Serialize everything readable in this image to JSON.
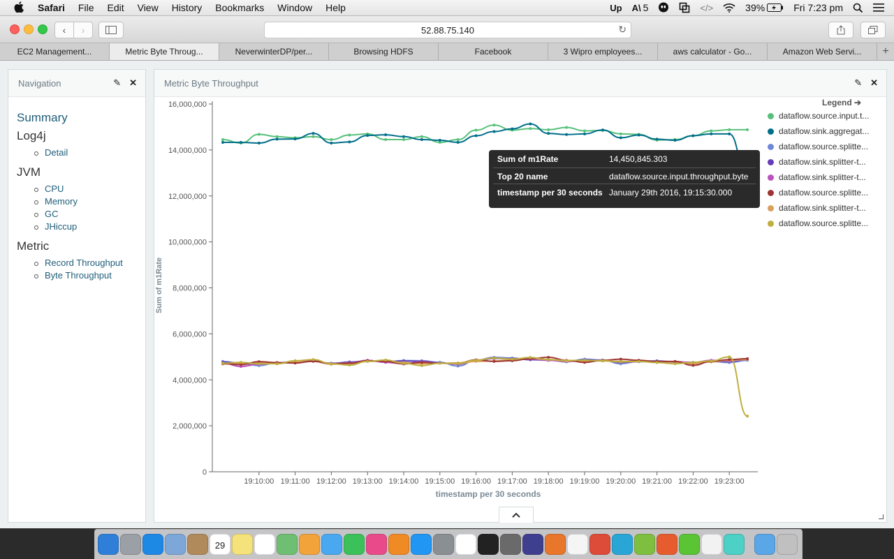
{
  "menubar": {
    "app": "Safari",
    "menus": [
      "File",
      "Edit",
      "View",
      "History",
      "Bookmarks",
      "Window",
      "Help"
    ],
    "notification_count": "5",
    "battery": "39%",
    "clock": "Fri 7:23 pm"
  },
  "browser": {
    "url": "52.88.75.140",
    "tabs": [
      "EC2 Management...",
      "Metric Byte Throug...",
      "NeverwinterDP/per...",
      "Browsing HDFS",
      "Facebook",
      "3 Wipro employees...",
      "aws calculator - Go...",
      "Amazon Web Servi..."
    ],
    "active_tab": 1
  },
  "navigation": {
    "title": "Navigation",
    "summary": "Summary",
    "sections": [
      {
        "heading": "Log4j",
        "items": [
          "Detail"
        ]
      },
      {
        "heading": "JVM",
        "items": [
          "CPU",
          "Memory",
          "GC",
          "JHiccup"
        ]
      },
      {
        "heading": "Metric",
        "items": [
          "Record Throughput",
          "Byte Throughput"
        ]
      }
    ]
  },
  "main_panel": {
    "title": "Metric Byte Throughput"
  },
  "legend": {
    "title": "Legend",
    "items": [
      {
        "label": "dataflow.source.input.t...",
        "color": "#57c17b"
      },
      {
        "label": "dataflow.sink.aggregat...",
        "color": "#006e8a"
      },
      {
        "label": "dataflow.source.splitte...",
        "color": "#6f87d8"
      },
      {
        "label": "dataflow.sink.splitter-t...",
        "color": "#663db8"
      },
      {
        "label": "dataflow.sink.splitter-t...",
        "color": "#bc52bc"
      },
      {
        "label": "dataflow.source.splitte...",
        "color": "#9e3533"
      },
      {
        "label": "dataflow.sink.splitter-t...",
        "color": "#daa05d"
      },
      {
        "label": "dataflow.source.splitte...",
        "color": "#bfaf40"
      }
    ]
  },
  "tooltip": {
    "rows": [
      {
        "key": "Sum of m1Rate",
        "value": "14,450,845.303"
      },
      {
        "key": "Top 20 name",
        "value": "dataflow.source.input.throughput.byte"
      },
      {
        "key": "timestamp per 30 seconds",
        "value": "January 29th 2016, 19:15:30.000"
      }
    ]
  },
  "chart_data": {
    "type": "line",
    "xlabel": "timestamp per 30 seconds",
    "ylabel": "Sum of m1Rate",
    "ylim": [
      0,
      16000000
    ],
    "yticks": [
      "0",
      "2,000,000",
      "4,000,000",
      "6,000,000",
      "8,000,000",
      "10,000,000",
      "12,000,000",
      "14,000,000",
      "16,000,000"
    ],
    "xticks": [
      "19:10:00",
      "19:11:00",
      "19:12:00",
      "19:13:00",
      "19:14:00",
      "19:15:00",
      "19:16:00",
      "19:17:00",
      "19:18:00",
      "19:19:00",
      "19:20:00",
      "19:21:00",
      "19:22:00",
      "19:23:00"
    ],
    "x": [
      "19:09:00",
      "19:09:30",
      "19:10:00",
      "19:10:30",
      "19:11:00",
      "19:11:30",
      "19:12:00",
      "19:12:30",
      "19:13:00",
      "19:13:30",
      "19:14:00",
      "19:14:30",
      "19:15:00",
      "19:15:30",
      "19:16:00",
      "19:16:30",
      "19:17:00",
      "19:17:30",
      "19:18:00",
      "19:18:30",
      "19:19:00",
      "19:19:30",
      "19:20:00",
      "19:20:30",
      "19:21:00",
      "19:21:30",
      "19:22:00",
      "19:22:30",
      "19:23:00",
      "19:23:30"
    ],
    "series": [
      {
        "name": "dataflow.source.input.t...",
        "color": "#57c17b",
        "values": [
          14450000,
          14300000,
          14680000,
          14580000,
          14530000,
          14580000,
          14450000,
          14650000,
          14700000,
          14450000,
          14450000,
          14580000,
          14330000,
          14450000,
          14860000,
          15080000,
          14860000,
          14930000,
          14880000,
          14980000,
          14830000,
          14850000,
          14700000,
          14680000,
          14430000,
          14450000,
          14620000,
          14830000,
          14880000,
          14880000
        ]
      },
      {
        "name": "dataflow.sink.aggregat...",
        "color": "#006e8a",
        "values": [
          14330000,
          14330000,
          14300000,
          14470000,
          14480000,
          14720000,
          14300000,
          14350000,
          14630000,
          14660000,
          14580000,
          14450000,
          14420000,
          14330000,
          14620000,
          14800000,
          14920000,
          15130000,
          14720000,
          14670000,
          14700000,
          14870000,
          14530000,
          14650000,
          14470000,
          14420000,
          14620000,
          14700000,
          14700000,
          12830000
        ]
      },
      {
        "name": "dataflow.source.splitte...",
        "color": "#6f87d8",
        "values": [
          4800000,
          4720000,
          4620000,
          4740000,
          4800000,
          4820000,
          4700000,
          4780000,
          4820000,
          4780000,
          4840000,
          4830000,
          4760000,
          4600000,
          4850000,
          4980000,
          4950000,
          4870000,
          4860000,
          4780000,
          4900000,
          4860000,
          4700000,
          4800000,
          4830000,
          4780000,
          4750000,
          4800000,
          4750000,
          4850000
        ]
      },
      {
        "name": "dataflow.sink.splitter-t...",
        "color": "#663db8",
        "values": [
          4760000,
          4740000,
          4700000,
          4720000,
          4790000,
          4840000,
          4720000,
          4760000,
          4820000,
          4800000,
          4820000,
          4800000,
          4740000,
          4680000,
          4830000,
          4930000,
          4920000,
          4880000,
          4850000,
          4810000,
          4860000,
          4840000,
          4760000,
          4790000,
          4800000,
          4770000,
          4760000,
          4820000,
          4800000,
          4880000
        ]
      },
      {
        "name": "dataflow.sink.splitter-t...",
        "color": "#bc52bc",
        "values": [
          4730000,
          4580000,
          4680000,
          4730000,
          4750000,
          4830000,
          4700000,
          4740000,
          4850000,
          4760000,
          4700000,
          4780000,
          4720000,
          4700000,
          4850000,
          4950000,
          4900000,
          4900000,
          4850000,
          4800000,
          4820000,
          4830000,
          4800000,
          4820000,
          4800000,
          4790000,
          4750000,
          4850000,
          4820000,
          4900000
        ]
      },
      {
        "name": "dataflow.source.splitte...",
        "color": "#9e3533",
        "values": [
          4700000,
          4660000,
          4790000,
          4750000,
          4730000,
          4810000,
          4700000,
          4720000,
          4830000,
          4800000,
          4690000,
          4760000,
          4720000,
          4730000,
          4870000,
          4800000,
          4830000,
          4920000,
          4980000,
          4850000,
          4760000,
          4850000,
          4900000,
          4850000,
          4800000,
          4800000,
          4630000,
          4800000,
          4880000,
          4920000
        ]
      },
      {
        "name": "dataflow.sink.splitter-t...",
        "color": "#daa05d",
        "values": [
          4700000,
          4700000,
          4760000,
          4700000,
          4780000,
          4800000,
          4680000,
          4700000,
          4800000,
          4820000,
          4750000,
          4700000,
          4720000,
          4700000,
          4800000,
          4820000,
          4870000,
          4930000,
          4880000,
          4820000,
          4820000,
          4820000,
          4780000,
          4800000,
          4800000,
          4780000,
          4700000,
          4780000,
          4850000,
          4880000
        ]
      },
      {
        "name": "dataflow.source.splitte...",
        "color": "#bfaf40",
        "values": [
          4720000,
          4760000,
          4700000,
          4700000,
          4830000,
          4880000,
          4700000,
          4640000,
          4800000,
          4860000,
          4720000,
          4620000,
          4720000,
          4730000,
          4850000,
          4950000,
          4900000,
          4970000,
          4880000,
          4840000,
          4850000,
          4830000,
          4800000,
          4800000,
          4750000,
          4700000,
          4760000,
          4820000,
          5000000,
          2420000
        ]
      }
    ],
    "legend_position": "right",
    "grid": false
  },
  "dock": {
    "icon_names": [
      "finder-icon",
      "launchpad-icon",
      "safari-icon",
      "preview-icon",
      "contacts-icon",
      "calendar-icon",
      "notes-icon",
      "reminders-icon",
      "maps-icon",
      "photos-icon",
      "messages-icon",
      "facetime-icon",
      "itunes-icon",
      "ibooks-icon",
      "app-store-icon",
      "system-preferences-icon",
      "slack-icon",
      "terminal-icon",
      "calculator-icon",
      "eclipse-icon",
      "firefox-icon",
      "grid-app-icon",
      "chrome-icon",
      "wunderlist-icon",
      "sourcetree-icon",
      "office-icon",
      "upwork-icon",
      "textedit-icon",
      "mou-icon",
      "folder-icon",
      "trash-icon"
    ],
    "calendar_day": "29"
  }
}
